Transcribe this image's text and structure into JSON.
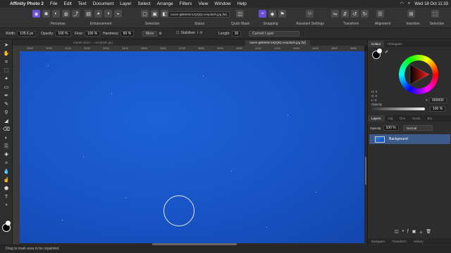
{
  "menubar": {
    "app_name": "Affinity Photo 2",
    "items": [
      "File",
      "Edit",
      "Text",
      "Document",
      "Layer",
      "Select",
      "Arrange",
      "Filters",
      "View",
      "Window",
      "Help"
    ],
    "datetime": "Wed 18 Oct 11:33"
  },
  "toolbar": {
    "groups": [
      "Personas",
      "Enhancement",
      "Selection",
      "Status",
      "Quick Mask",
      "Snapping",
      "Assistant Settings",
      "Transform",
      "Alignment",
      "Insertion",
      "Selection"
    ]
  },
  "context": {
    "width_label": "Width:",
    "width_value": "105.6 px",
    "opacity_label": "Opacity:",
    "opacity_value": "100 %",
    "flow_label": "Flow:",
    "flow_value": "100 %",
    "hardness_label": "Hardness:",
    "hardness_value": "80 %",
    "more_label": "More",
    "stabiliser_label": "Stabiliser",
    "length_label": "Length:",
    "length_value": "30",
    "layer_source": "Current Layer"
  },
  "documents": {
    "tab_inactive": "marek-okon-...-unsplash.jpg",
    "tab_active": "naom-gBMe5mUQQiQ-unsplash.jpg [M]"
  },
  "ruler": [
    "2900",
    "3000",
    "3100",
    "3200",
    "3300",
    "3400",
    "3500",
    "3600",
    "3700",
    "3800",
    "3900",
    "4000",
    "4100",
    "4200",
    "4300",
    "4400",
    "4500",
    "4600"
  ],
  "status": "Drag to mark area to be repainted.",
  "panels": {
    "color_tabs": [
      "Colour",
      "Histogram"
    ],
    "hsl": [
      "H: 0",
      "S: 0",
      "L: 0"
    ],
    "hex_label": "#:",
    "hex_value": "000000",
    "opacity_label": "Opacity",
    "opacity_value": "100 %",
    "layer_tabs": [
      "Layers",
      "Adj",
      "Chn",
      "Stock",
      "Brs"
    ],
    "layers_opacity_label": "Opacity:",
    "layers_opacity_value": "100 %",
    "blend_mode": "Normal",
    "layers": [
      {
        "name": "Background"
      }
    ],
    "bottom_tabs": [
      "Navigator",
      "Transform",
      "History"
    ]
  },
  "colors": {
    "accent": "#6b4fd8",
    "canvas_blue": "#1854c6",
    "layer_selected": "#3c5a8a"
  }
}
